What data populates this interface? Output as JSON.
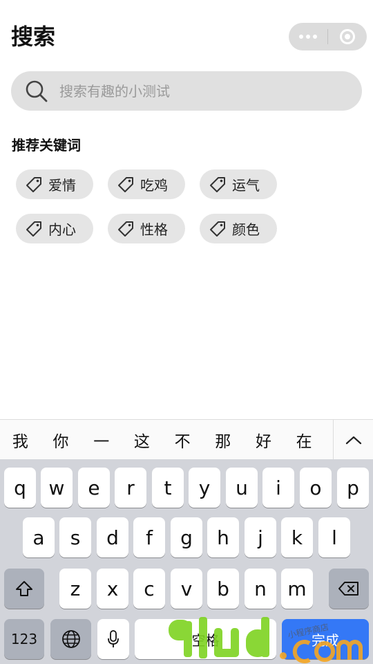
{
  "header": {
    "title": "搜索"
  },
  "search": {
    "placeholder": "搜索有趣的小测试"
  },
  "recommend": {
    "heading": "推荐关键词",
    "tags": [
      "爱情",
      "吃鸡",
      "运气",
      "内心",
      "性格",
      "颜色"
    ]
  },
  "keyboard": {
    "candidates": [
      "我",
      "你",
      "一",
      "这",
      "不",
      "那",
      "好",
      "在"
    ],
    "row1": [
      "q",
      "w",
      "e",
      "r",
      "t",
      "y",
      "u",
      "i",
      "o",
      "p"
    ],
    "row2": [
      "a",
      "s",
      "d",
      "f",
      "g",
      "h",
      "j",
      "k",
      "l"
    ],
    "row3": [
      "z",
      "x",
      "c",
      "v",
      "b",
      "n",
      "m"
    ],
    "num_label": "123",
    "space_label": "空格",
    "done_label": "完成"
  },
  "watermark": {
    "text_main": "9lud.com",
    "text_small": "小程序商店"
  },
  "colors": {
    "accent_blue": "#3478f6",
    "watermark_green": "#7ed321",
    "watermark_orange": "#f5a623"
  }
}
